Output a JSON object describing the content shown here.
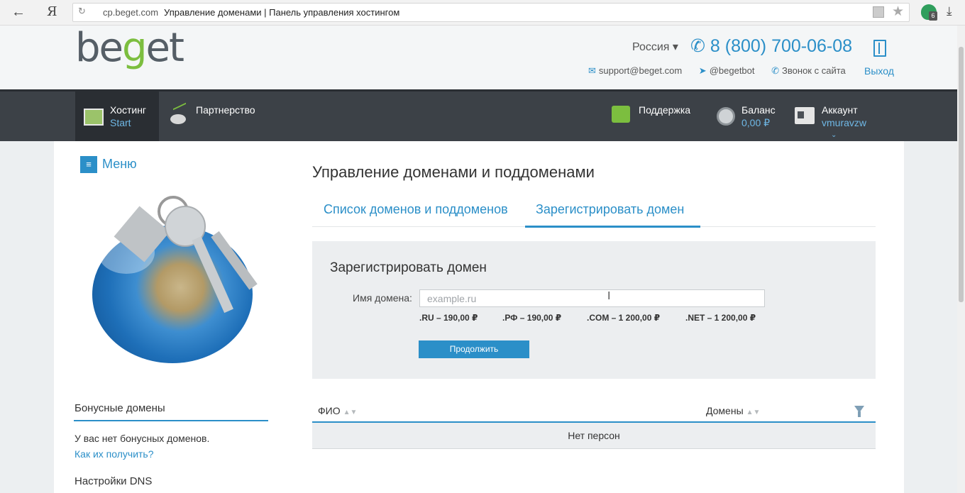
{
  "browser": {
    "back_icon": "←",
    "yandex_icon": "Я",
    "url_domain": "cp.beget.com",
    "page_title": "Управление доменами | Панель управления хостингом"
  },
  "header": {
    "logo_part1": "be",
    "logo_g": "g",
    "logo_part2": "et",
    "region": "Россия ▾",
    "phone": "8 (800) 700-06-08",
    "email": "support@beget.com",
    "telegram": "@begetbot",
    "call": "Звонок с сайта",
    "logout": "Выход"
  },
  "nav": {
    "hosting_title": "Хостинг",
    "hosting_plan": "Start",
    "partner": "Партнерство",
    "support": "Поддержка",
    "balance_title": "Баланс",
    "balance_value": "0,00 ₽",
    "account_title": "Аккаунт",
    "account_user": "vmuravzw"
  },
  "sidebar": {
    "menu": "Меню",
    "bonus_title": "Бонусные домены",
    "bonus_text": "У вас нет бонусных доменов.",
    "bonus_link": "Как их получить?",
    "dns_title": "Настройки DNS"
  },
  "main": {
    "title": "Управление доменами и поддоменами",
    "tabs": [
      {
        "label": "Список доменов и поддоменов"
      },
      {
        "label": "Зарегистрировать домен"
      }
    ],
    "register": {
      "title": "Зарегистрировать домен",
      "label": "Имя домена:",
      "placeholder": "example.ru",
      "prices": [
        ".RU – 190,00 ₽",
        ".РФ – 190,00 ₽",
        ".COM – 1 200,00 ₽",
        ".NET – 1 200,00 ₽"
      ],
      "button": "Продолжить"
    },
    "table": {
      "col_name": "ФИО",
      "col_domains": "Домены",
      "empty": "Нет персон"
    }
  },
  "colors": {
    "accent": "#2b8fc8",
    "logo_green": "#7cbe3f",
    "nav_bg": "#3c4147"
  }
}
